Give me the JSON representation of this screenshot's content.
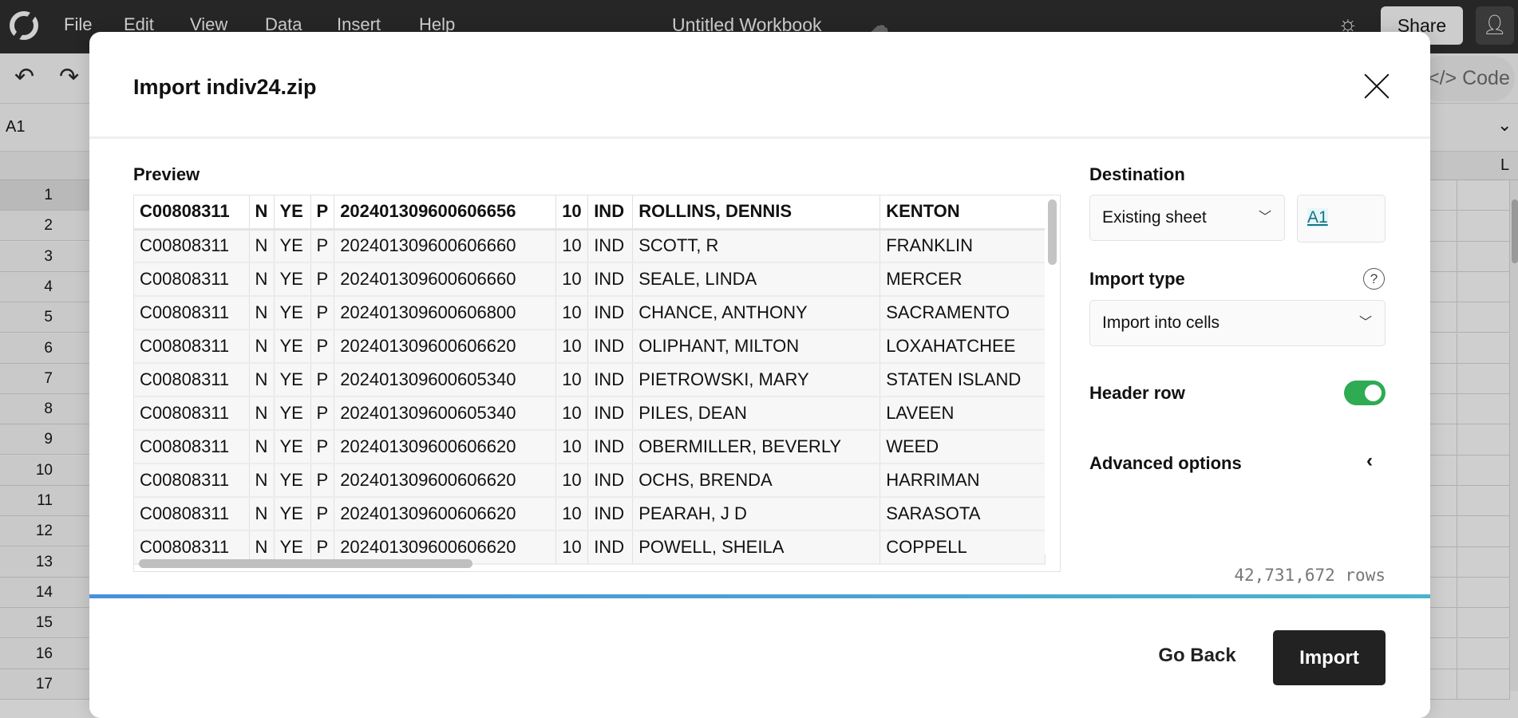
{
  "app": {
    "menu": [
      "File",
      "Edit",
      "View",
      "Data",
      "Insert",
      "Help"
    ],
    "workbook_title": "Untitled Workbook",
    "share_label": "Share",
    "code_label": "</> Code",
    "cell_ref": "A1",
    "column_partial": "L",
    "row_numbers": [
      "1",
      "2",
      "3",
      "4",
      "5",
      "6",
      "7",
      "8",
      "9",
      "10",
      "11",
      "12",
      "13",
      "14",
      "15",
      "16",
      "17"
    ]
  },
  "dialog": {
    "title": "Import indiv24.zip",
    "preview_label": "Preview",
    "columns": [
      "C00808311",
      "N",
      "YE",
      "P",
      "202401309600606656",
      "10",
      "IND",
      "ROLLINS, DENNIS",
      "KENTON"
    ],
    "rows": [
      [
        "C00808311",
        "N",
        "YE",
        "P",
        "202401309600606660",
        "10",
        "IND",
        "SCOTT, R",
        "FRANKLIN"
      ],
      [
        "C00808311",
        "N",
        "YE",
        "P",
        "202401309600606660",
        "10",
        "IND",
        "SEALE, LINDA",
        "MERCER"
      ],
      [
        "C00808311",
        "N",
        "YE",
        "P",
        "202401309600606800",
        "10",
        "IND",
        "CHANCE, ANTHONY",
        "SACRAMENTO"
      ],
      [
        "C00808311",
        "N",
        "YE",
        "P",
        "202401309600606620",
        "10",
        "IND",
        "OLIPHANT, MILTON",
        "LOXAHATCHEE"
      ],
      [
        "C00808311",
        "N",
        "YE",
        "P",
        "202401309600605340",
        "10",
        "IND",
        "PIETROWSKI, MARY",
        "STATEN ISLAND"
      ],
      [
        "C00808311",
        "N",
        "YE",
        "P",
        "202401309600605340",
        "10",
        "IND",
        "PILES, DEAN",
        "LAVEEN"
      ],
      [
        "C00808311",
        "N",
        "YE",
        "P",
        "202401309600606620",
        "10",
        "IND",
        "OBERMILLER, BEVERLY",
        "WEED"
      ],
      [
        "C00808311",
        "N",
        "YE",
        "P",
        "202401309600606620",
        "10",
        "IND",
        "OCHS, BRENDA",
        "HARRIMAN"
      ],
      [
        "C00808311",
        "N",
        "YE",
        "P",
        "202401309600606620",
        "10",
        "IND",
        "PEARAH, J D",
        "SARASOTA"
      ],
      [
        "C00808311",
        "N",
        "YE",
        "P",
        "202401309600606620",
        "10",
        "IND",
        "POWELL, SHEILA",
        "COPPELL"
      ]
    ],
    "destination": {
      "label": "Destination",
      "sheet_option": "Existing sheet",
      "cell": "A1"
    },
    "import_type": {
      "label": "Import type",
      "value": "Import into cells"
    },
    "header_row": {
      "label": "Header row",
      "enabled": true,
      "color": "#2eab53"
    },
    "advanced_label": "Advanced options",
    "row_count": "42,731,672 rows",
    "progress": 1.0,
    "go_back_label": "Go Back",
    "import_label": "Import"
  }
}
